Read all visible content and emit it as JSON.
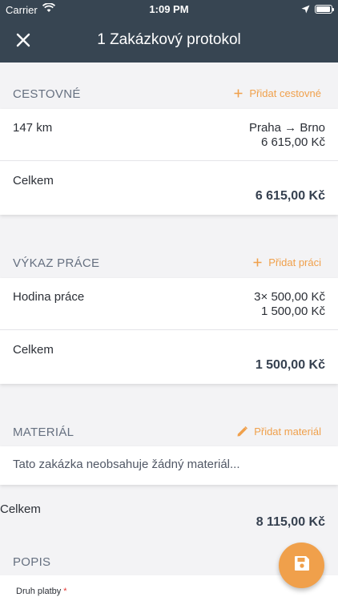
{
  "status_bar": {
    "carrier": "Carrier",
    "time": "1:09 PM"
  },
  "nav": {
    "title": "1 Zakázkový protokol",
    "close_icon": "close-icon"
  },
  "colors": {
    "nav_bg": "#374552",
    "accent": "#f0a04b",
    "required": "#e53935"
  },
  "travel": {
    "header": "CESTOVNÉ",
    "action_label": "Přidat cestovné",
    "items": [
      {
        "distance": "147 km",
        "route": "Praha → Brno",
        "amount": "6 615,00 Kč"
      }
    ],
    "total_label": "Celkem",
    "total_value": "6 615,00 Kč"
  },
  "work": {
    "header": "VÝKAZ PRÁCE",
    "action_label": "Přidat práci",
    "items": [
      {
        "name": "Hodina práce",
        "quantity_price": "3× 500,00 Kč",
        "amount": "1 500,00 Kč"
      }
    ],
    "total_label": "Celkem",
    "total_value": "1 500,00 Kč"
  },
  "material": {
    "header": "MATERIÁL",
    "action_label": "Přidat materiál",
    "empty_text": "Tato zakázka neobsahuje žádný materiál..."
  },
  "overall": {
    "label": "Celkem",
    "value": "8 115,00 Kč"
  },
  "description": {
    "header": "POPIS",
    "field_label": "Druh platby",
    "required_mark": "*"
  },
  "fab": {
    "icon": "save-icon"
  }
}
